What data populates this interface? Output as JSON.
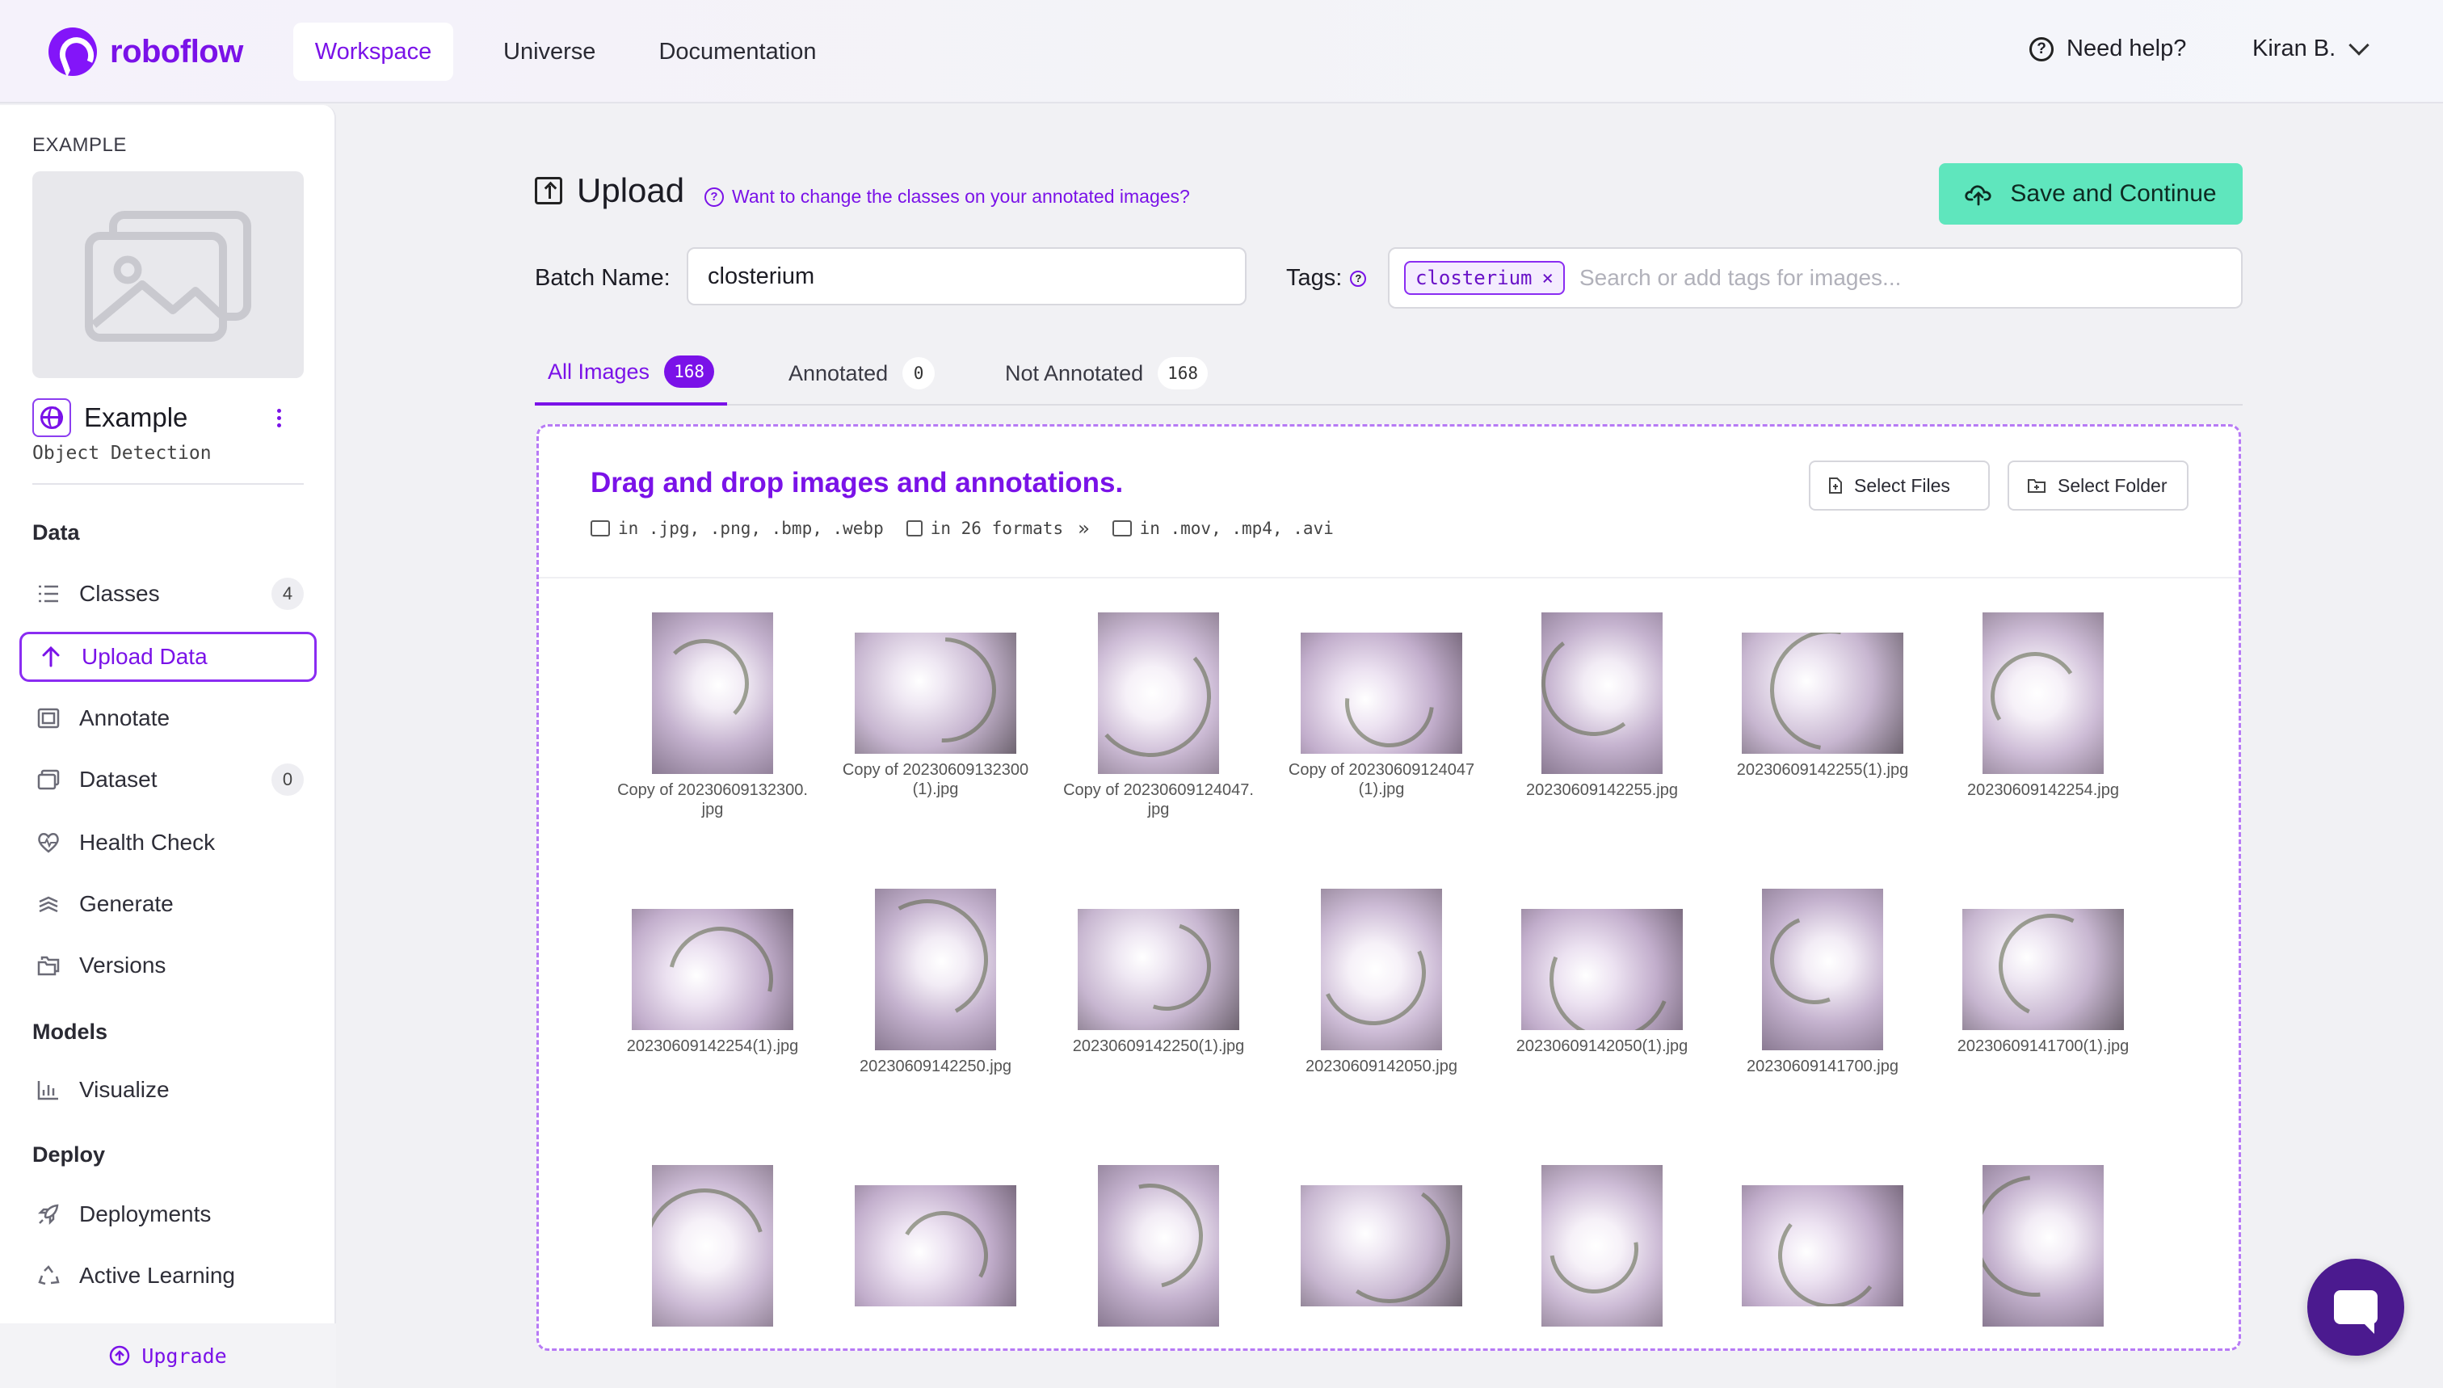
{
  "header": {
    "logo_text": "roboflow",
    "nav": [
      {
        "label": "Workspace",
        "active": true
      },
      {
        "label": "Universe",
        "active": false
      },
      {
        "label": "Documentation",
        "active": false
      }
    ],
    "help_label": "Need help?",
    "user_label": "Kiran B."
  },
  "sidebar": {
    "project_label": "EXAMPLE",
    "project_name": "Example",
    "project_type": "Object Detection",
    "sections": {
      "data": "Data",
      "models": "Models",
      "deploy": "Deploy"
    },
    "items": [
      {
        "label": "Classes",
        "icon": "list-icon",
        "count": "4"
      },
      {
        "label": "Upload Data",
        "icon": "arrow-up-icon",
        "active": true
      },
      {
        "label": "Annotate",
        "icon": "annotate-icon"
      },
      {
        "label": "Dataset",
        "icon": "images-icon",
        "count": "0"
      },
      {
        "label": "Health Check",
        "icon": "heart-pulse-icon"
      },
      {
        "label": "Generate",
        "icon": "layers-icon"
      },
      {
        "label": "Versions",
        "icon": "folders-icon"
      },
      {
        "label": "Visualize",
        "icon": "bar-chart-icon"
      },
      {
        "label": "Deployments",
        "icon": "rocket-icon"
      },
      {
        "label": "Active Learning",
        "icon": "recycle-icon"
      }
    ],
    "upgrade_label": "Upgrade"
  },
  "main": {
    "title": "Upload",
    "change_classes_link": "Want to change the classes on your annotated images?",
    "save_button": "Save and Continue",
    "batch_label": "Batch Name:",
    "batch_value": "closterium",
    "tags_label": "Tags:",
    "tags": [
      "closterium"
    ],
    "tags_placeholder": "Search or add tags for images...",
    "tabs": [
      {
        "label": "All Images",
        "count": "168",
        "active": true
      },
      {
        "label": "Annotated",
        "count": "0",
        "active": false
      },
      {
        "label": "Not Annotated",
        "count": "168",
        "active": false
      }
    ],
    "dropzone": {
      "title": "Drag and drop images and annotations.",
      "image_formats": "in .jpg, .png, .bmp, .webp",
      "annotation_formats": "in 26 formats",
      "video_formats": "in .mov, .mp4, .avi",
      "select_files": "Select Files",
      "select_folder": "Select Folder"
    },
    "images": [
      {
        "caption": "Copy of 20230609132300.jpg"
      },
      {
        "caption": "Copy of 20230609132300(1).jpg"
      },
      {
        "caption": "Copy of 20230609124047.jpg"
      },
      {
        "caption": "Copy of 20230609124047(1).jpg"
      },
      {
        "caption": "20230609142255.jpg"
      },
      {
        "caption": "20230609142255(1).jpg"
      },
      {
        "caption": "20230609142254.jpg"
      },
      {
        "caption": "20230609142254(1).jpg"
      },
      {
        "caption": "20230609142250.jpg"
      },
      {
        "caption": "20230609142250(1).jpg"
      },
      {
        "caption": "20230609142050.jpg"
      },
      {
        "caption": "20230609142050(1).jpg"
      },
      {
        "caption": "20230609141700.jpg"
      },
      {
        "caption": "20230609141700(1).jpg"
      },
      {
        "caption": ""
      },
      {
        "caption": ""
      },
      {
        "caption": ""
      },
      {
        "caption": ""
      },
      {
        "caption": ""
      },
      {
        "caption": ""
      },
      {
        "caption": ""
      }
    ]
  },
  "colors": {
    "brand_purple": "#7a12e8",
    "save_green": "#5fe6bd",
    "chat_purple": "#4b1a8f"
  }
}
